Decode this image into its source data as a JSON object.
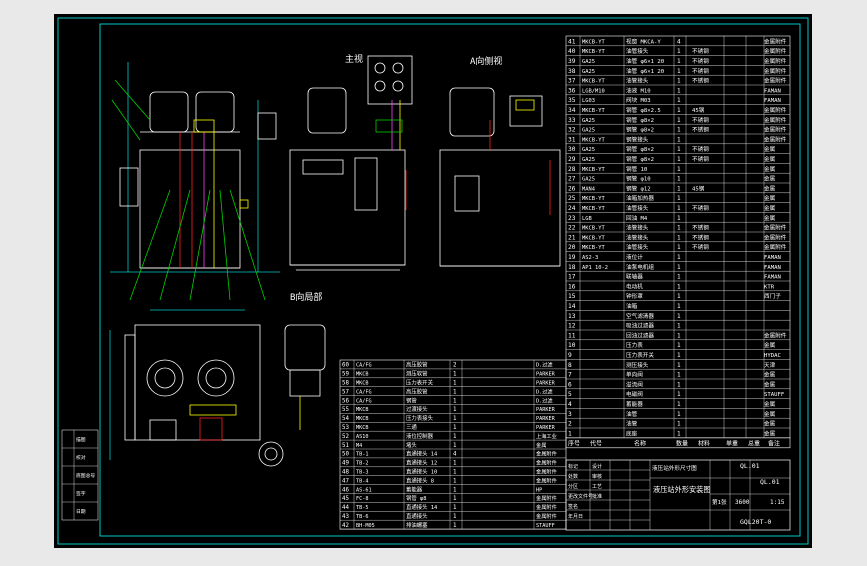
{
  "colors": {
    "background": "#e9e9e9",
    "sheet": "#000000",
    "border": "#00c8c8",
    "geometry": "#ffffff",
    "table_text": "#ffffff",
    "accent_yellow": "#ffff00",
    "accent_red": "#ff2020",
    "accent_green": "#00d000",
    "accent_magenta": "#ff40ff"
  },
  "views": {
    "front_title": "主视",
    "left_title": "A向侧视",
    "top_title": "B向局部"
  },
  "right_parts_table": {
    "rows": [
      {
        "no": "41",
        "code": "MKCB-YT",
        "name": "视窗 MKCA-Y",
        "qty": "4",
        "spec": "",
        "mat": "",
        "note": "金属附件"
      },
      {
        "no": "40",
        "code": "MKCB-YT",
        "name": "油管接头",
        "qty": "1",
        "spec": "不锈钢",
        "mat": "",
        "note": "金属附件"
      },
      {
        "no": "39",
        "code": "GA25",
        "name": "油管 φ6×1 20",
        "qty": "1",
        "spec": "不锈钢",
        "mat": "",
        "note": "金属附件"
      },
      {
        "no": "38",
        "code": "GA25",
        "name": "油管 φ6×1 20",
        "qty": "1",
        "spec": "不锈钢",
        "mat": "",
        "note": "金属附件"
      },
      {
        "no": "37",
        "code": "MKCB-YT",
        "name": "油管接头",
        "qty": "1",
        "spec": "不锈钢",
        "mat": "",
        "note": "金属附件"
      },
      {
        "no": "36",
        "code": "LGB/M10",
        "name": "油液 M10",
        "qty": "1",
        "spec": "",
        "mat": "",
        "note": "FAMAN"
      },
      {
        "no": "35",
        "code": "LG03",
        "name": "阀块 M03",
        "qty": "1",
        "spec": "",
        "mat": "",
        "note": "FAMAN"
      },
      {
        "no": "34",
        "code": "MKCB-YT",
        "name": "钢管 φ8×2.5",
        "qty": "1",
        "spec": "45钢",
        "mat": "",
        "note": "金属附件"
      },
      {
        "no": "33",
        "code": "GA25",
        "name": "钢管 φ8×2",
        "qty": "1",
        "spec": "不锈钢",
        "mat": "",
        "note": "金属附件"
      },
      {
        "no": "32",
        "code": "GA25",
        "name": "钢管 φ8×2",
        "qty": "1",
        "spec": "不锈钢",
        "mat": "",
        "note": "金属附件"
      },
      {
        "no": "31",
        "code": "MKCB-YT",
        "name": "钢管接头",
        "qty": "1",
        "spec": "",
        "mat": "",
        "note": "金属附件"
      },
      {
        "no": "30",
        "code": "GA25",
        "name": "钢管 φ8×2",
        "qty": "1",
        "spec": "不锈钢",
        "mat": "",
        "note": "金属"
      },
      {
        "no": "29",
        "code": "GA25",
        "name": "钢管 φ8×2",
        "qty": "1",
        "spec": "不锈钢",
        "mat": "",
        "note": "金属"
      },
      {
        "no": "28",
        "code": "MKCB-YT",
        "name": "钢管 10",
        "qty": "1",
        "spec": "",
        "mat": "",
        "note": "金属"
      },
      {
        "no": "27",
        "code": "GA25",
        "name": "钢管 φ10",
        "qty": "1",
        "spec": "",
        "mat": "",
        "note": "金属"
      },
      {
        "no": "26",
        "code": "MAN4",
        "name": "钢管 φ12",
        "qty": "1",
        "spec": "45钢",
        "mat": "",
        "note": "金属"
      },
      {
        "no": "25",
        "code": "MKCB-YT",
        "name": "油箱加热器",
        "qty": "1",
        "spec": "",
        "mat": "",
        "note": "金属"
      },
      {
        "no": "24",
        "code": "MKCB-YT",
        "name": "油管接头",
        "qty": "1",
        "spec": "不锈钢",
        "mat": "",
        "note": "金属"
      },
      {
        "no": "23",
        "code": "LGB",
        "name": "回油 M4",
        "qty": "1",
        "spec": "",
        "mat": "",
        "note": "金属"
      },
      {
        "no": "22",
        "code": "MKCB-YT",
        "name": "油管接头",
        "qty": "1",
        "spec": "不锈钢",
        "mat": "",
        "note": "金属附件"
      },
      {
        "no": "21",
        "code": "MKCB-YT",
        "name": "油管接头",
        "qty": "1",
        "spec": "不锈钢",
        "mat": "",
        "note": "金属附件"
      },
      {
        "no": "20",
        "code": "MKCB-YT",
        "name": "油管接头",
        "qty": "1",
        "spec": "不锈钢",
        "mat": "",
        "note": "金属附件"
      },
      {
        "no": "19",
        "code": "AS2-3",
        "name": "液位计",
        "qty": "1",
        "spec": "",
        "mat": "",
        "note": "FAMAN"
      },
      {
        "no": "18",
        "code": "AP1 10-2",
        "name": "油泵电机组",
        "qty": "1",
        "spec": "",
        "mat": "",
        "note": "FAMAN"
      },
      {
        "no": "17",
        "code": "",
        "name": "联轴器",
        "qty": "1",
        "spec": "",
        "mat": "",
        "note": "FAMAN"
      },
      {
        "no": "16",
        "code": "",
        "name": "电动机",
        "qty": "1",
        "spec": "",
        "mat": "",
        "note": "KTR"
      },
      {
        "no": "15",
        "code": "",
        "name": "钟形罩",
        "qty": "1",
        "spec": "",
        "mat": "",
        "note": "西门子"
      },
      {
        "no": "14",
        "code": "",
        "name": "油箱",
        "qty": "1",
        "spec": "",
        "mat": "",
        "note": ""
      },
      {
        "no": "13",
        "code": "",
        "name": "空气滤清器",
        "qty": "1",
        "spec": "",
        "mat": "",
        "note": ""
      },
      {
        "no": "12",
        "code": "",
        "name": "吸油过滤器",
        "qty": "1",
        "spec": "",
        "mat": "",
        "note": ""
      },
      {
        "no": "11",
        "code": "",
        "name": "回油过滤器",
        "qty": "1",
        "spec": "",
        "mat": "",
        "note": "金属附件"
      },
      {
        "no": "10",
        "code": "",
        "name": "压力表",
        "qty": "1",
        "spec": "",
        "mat": "",
        "note": "金属"
      },
      {
        "no": "9",
        "code": "",
        "name": "压力表开关",
        "qty": "1",
        "spec": "",
        "mat": "",
        "note": "HYDAC"
      },
      {
        "no": "8",
        "code": "",
        "name": "测压接头",
        "qty": "1",
        "spec": "",
        "mat": "",
        "note": "天津"
      },
      {
        "no": "7",
        "code": "",
        "name": "单向阀",
        "qty": "1",
        "spec": "",
        "mat": "",
        "note": "金属"
      },
      {
        "no": "6",
        "code": "",
        "name": "溢流阀",
        "qty": "1",
        "spec": "",
        "mat": "",
        "note": "金属"
      },
      {
        "no": "5",
        "code": "",
        "name": "电磁阀",
        "qty": "1",
        "spec": "",
        "mat": "",
        "note": "STAUFF"
      },
      {
        "no": "4",
        "code": "",
        "name": "蓄能器",
        "qty": "1",
        "spec": "",
        "mat": "",
        "note": "金属"
      },
      {
        "no": "3",
        "code": "",
        "name": "油管",
        "qty": "1",
        "spec": "",
        "mat": "",
        "note": "金属"
      },
      {
        "no": "2",
        "code": "",
        "name": "油管",
        "qty": "1",
        "spec": "",
        "mat": "",
        "note": "金属"
      },
      {
        "no": "1",
        "code": "",
        "name": "底座",
        "qty": "1",
        "spec": "",
        "mat": "",
        "note": "金属"
      }
    ],
    "header": [
      "序号",
      "代号",
      "名称",
      "数量",
      "材料",
      "单重",
      "总重",
      "备注"
    ]
  },
  "lower_parts_table": {
    "rows": [
      {
        "no": "60",
        "code": "CA/FG",
        "name": "高压胶管",
        "qty": "2",
        "note": "D.过滤"
      },
      {
        "no": "59",
        "code": "MKCB",
        "name": "测压软管",
        "qty": "1",
        "note": "PARKER"
      },
      {
        "no": "58",
        "code": "MKCB",
        "name": "压力表开关",
        "qty": "1",
        "note": "PARKER"
      },
      {
        "no": "57",
        "code": "CA/FG",
        "name": "高压胶管",
        "qty": "1",
        "note": "D.过滤"
      },
      {
        "no": "56",
        "code": "CA/FG",
        "name": "钢管",
        "qty": "1",
        "note": "D.过滤"
      },
      {
        "no": "55",
        "code": "MKCB",
        "name": "过渡接头",
        "qty": "1",
        "note": "PARKER"
      },
      {
        "no": "54",
        "code": "MKCB",
        "name": "压力表接头",
        "qty": "1",
        "note": "PARKER"
      },
      {
        "no": "53",
        "code": "MKCB",
        "name": "三通",
        "qty": "1",
        "note": "PARKER"
      },
      {
        "no": "52",
        "code": "AS10",
        "name": "液位控制器",
        "qty": "1",
        "note": "上海工业"
      },
      {
        "no": "51",
        "code": "M4",
        "name": "堵头",
        "qty": "1",
        "note": "金属"
      },
      {
        "no": "50",
        "code": "TB-1",
        "name": "直通接头 14",
        "qty": "4",
        "note": "金属附件"
      },
      {
        "no": "49",
        "code": "TB-2",
        "name": "直通接头 12",
        "qty": "1",
        "note": "金属附件"
      },
      {
        "no": "48",
        "code": "TB-3",
        "name": "直通接头 10",
        "qty": "1",
        "note": "金属附件"
      },
      {
        "no": "47",
        "code": "TB-4",
        "name": "直通接头 8",
        "qty": "1",
        "note": "金属附件"
      },
      {
        "no": "46",
        "code": "AS-61",
        "name": "蓄能器",
        "qty": "1",
        "note": "HP"
      },
      {
        "no": "45",
        "code": "FC-8",
        "name": "钢管 φ8",
        "qty": "1",
        "note": "金属附件"
      },
      {
        "no": "44",
        "code": "TB-5",
        "name": "直通接头 14",
        "qty": "1",
        "note": "金属附件"
      },
      {
        "no": "43",
        "code": "TB-6",
        "name": "直通接头",
        "qty": "1",
        "note": "金属附件"
      },
      {
        "no": "42",
        "code": "BH-M05",
        "name": "排油螺塞",
        "qty": "1",
        "note": "STAUFF"
      }
    ]
  },
  "title_block": {
    "project_code": "QL.01",
    "drawing_number": "QL.01",
    "drawing_title": "液压站外形安装图",
    "company": "液压站外形尺寸图",
    "scale": "1:15",
    "sheet_info": "第1张",
    "weight": "3600",
    "doc_number": "GQL20T-0",
    "labels": [
      "标记",
      "处数",
      "分区",
      "更改文件号",
      "签名",
      "年月日",
      "设计",
      "审核",
      "工艺",
      "批准"
    ]
  },
  "left_stamp": {
    "labels": [
      "描图",
      "校对",
      "底图总号",
      "签字",
      "日期"
    ]
  }
}
